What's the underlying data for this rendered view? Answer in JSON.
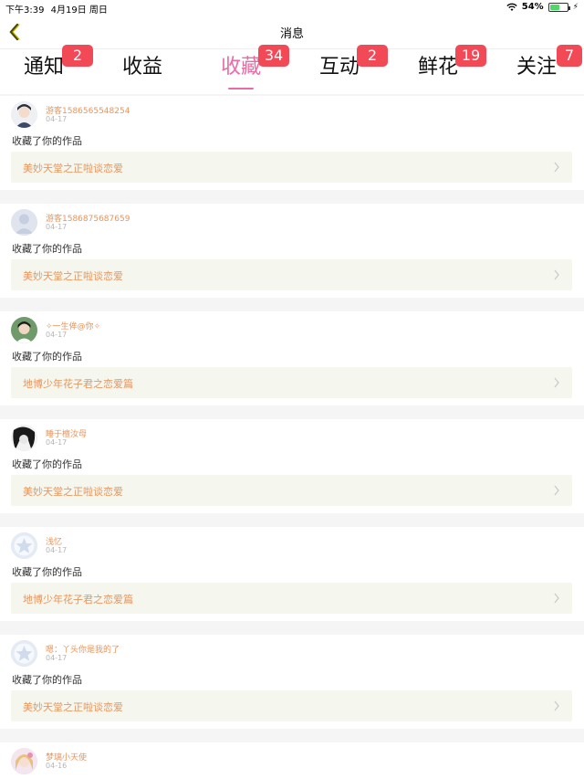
{
  "status_bar": {
    "time": "下午3:39",
    "date": "4月19日 周日",
    "battery": "54%"
  },
  "nav": {
    "title": "消息"
  },
  "tabs": [
    {
      "label": "通知",
      "badge": "2",
      "active": false
    },
    {
      "label": "收益",
      "badge": "",
      "active": false
    },
    {
      "label": "收藏",
      "badge": "34",
      "active": true
    },
    {
      "label": "互动",
      "badge": "2",
      "active": false
    },
    {
      "label": "鲜花",
      "badge": "19",
      "active": false
    },
    {
      "label": "关注",
      "badge": "7",
      "active": false
    }
  ],
  "messages": [
    {
      "user": "游客1586565548254",
      "date": "04-17",
      "action": "收藏了你的作品",
      "work": "美妙天堂之正啦谈恋爱",
      "avatar": "avatar-photo-boy"
    },
    {
      "user": "游客1586875687659",
      "date": "04-17",
      "action": "收藏了你的作品",
      "work": "美妙天堂之正啦谈恋爱",
      "avatar": "avatar-default"
    },
    {
      "user": "✧一生侔@你✧",
      "date": "04-17",
      "action": "收藏了你的作品",
      "work": "地博少年花子君之恋爱篇",
      "avatar": "avatar-photo-green"
    },
    {
      "user": "睡于檀汝母",
      "date": "04-17",
      "action": "收藏了你的作品",
      "work": "美妙天堂之正啦谈恋爱",
      "avatar": "avatar-photo-dark"
    },
    {
      "user": "浅忆",
      "date": "04-17",
      "action": "收藏了你的作品",
      "work": "地博少年花子君之恋爱篇",
      "avatar": "avatar-star"
    },
    {
      "user": "嗯：丫头你是我的了",
      "date": "04-17",
      "action": "收藏了你的作品",
      "work": "美妙天堂之正啦谈恋爱",
      "avatar": "avatar-star"
    },
    {
      "user": "梦璃小天使",
      "date": "04-16",
      "action": "",
      "work": "",
      "avatar": "avatar-photo-pink"
    }
  ],
  "colors": {
    "accent": "#ea6aa3",
    "badge": "#f24957",
    "link": "#e8955d",
    "work_bg": "#f5f6ee"
  }
}
